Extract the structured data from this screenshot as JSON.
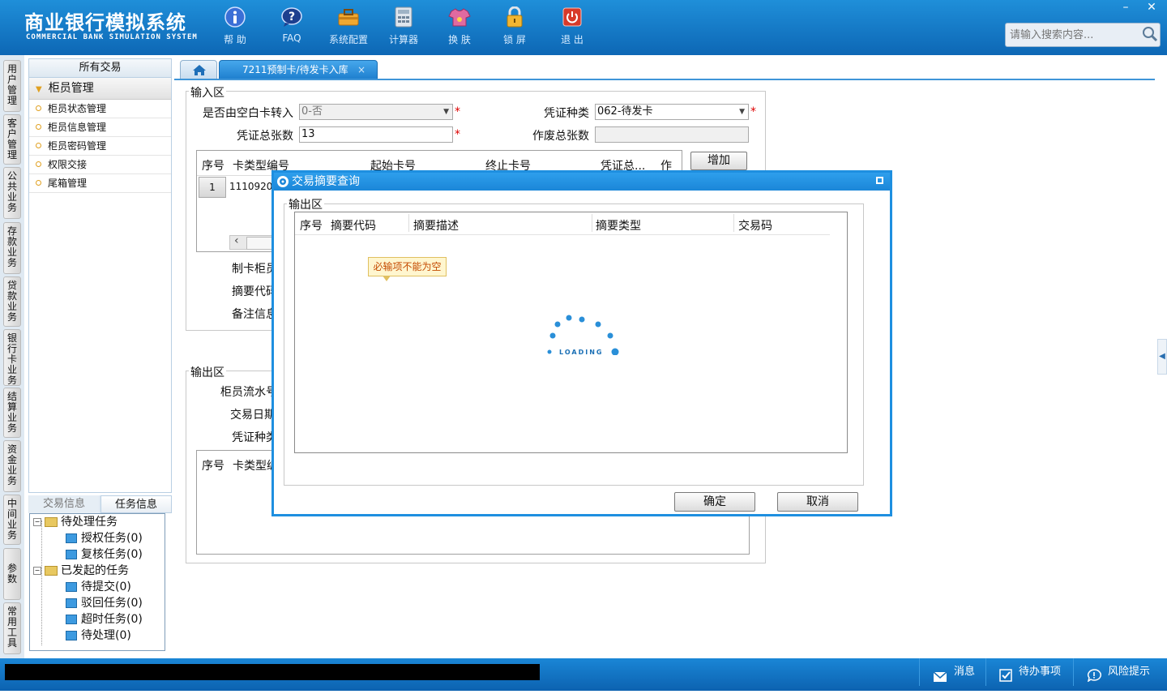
{
  "app": {
    "title_cn": "商业银行模拟系统",
    "title_en": "COMMERCIAL BANK SIMULATION SYSTEM"
  },
  "toolbar": [
    {
      "label": "帮 助",
      "icon": "info-icon"
    },
    {
      "label": "FAQ",
      "icon": "question-icon"
    },
    {
      "label": "系统配置",
      "icon": "toolbox-icon"
    },
    {
      "label": "计算器",
      "icon": "calculator-icon"
    },
    {
      "label": "换 肤",
      "icon": "shirt-icon"
    },
    {
      "label": "锁 屏",
      "icon": "lock-icon"
    },
    {
      "label": "退 出",
      "icon": "power-icon"
    }
  ],
  "search": {
    "placeholder": "请输入搜索内容..."
  },
  "window_controls": {
    "minimize": "–",
    "close": "✕"
  },
  "side_tabs": [
    "用户管理",
    "客户管理",
    "公共业务",
    "存款业务",
    "贷款业务",
    "银行卡业务",
    "结算业务",
    "资金业务",
    "中间业务",
    "参数",
    "常用工具"
  ],
  "menu": {
    "header": "所有交易",
    "group": "柜员管理",
    "items": [
      "柜员状态管理",
      "柜员信息管理",
      "柜员密码管理",
      "权限交接",
      "尾箱管理"
    ]
  },
  "task_panel": {
    "tabs": [
      "交易信息",
      "任务信息"
    ],
    "pending_label": "待处理任务",
    "pending_items": [
      "授权任务(0)",
      "复核任务(0)"
    ],
    "initiated_label": "已发起的任务",
    "initiated_items": [
      "待提交(0)",
      "驳回任务(0)",
      "超时任务(0)",
      "待处理(0)"
    ]
  },
  "tabs": {
    "active": "7211预制卡/待发卡入库",
    "close": "×"
  },
  "form": {
    "input_legend": "输入区",
    "blank_card_label": "是否由空白卡转入",
    "blank_card_value": "0-否",
    "voucher_type_label": "凭证种类",
    "voucher_type_value": "062-待发卡",
    "total_label": "凭证总张数",
    "total_value": "13",
    "void_label": "作废总张数",
    "void_value": "",
    "add_button": "增加",
    "grid_headers": [
      "序号",
      "卡类型编号",
      "起始卡号",
      "终止卡号",
      "凭证总...",
      "作废"
    ],
    "grid_row": {
      "index": "1",
      "card_type": "1110920"
    },
    "scroll_left": "‹",
    "maker_label": "制卡柜员",
    "summary_label": "摘要代码",
    "remark_label": "备注信息",
    "output_legend": "输出区",
    "teller_serial_label": "柜员流水号",
    "trade_date_label": "交易日期",
    "voucher_type2_label": "凭证种类",
    "out_grid_headers": [
      "序号",
      "卡类型编号"
    ],
    "required_mark": "*"
  },
  "modal": {
    "title": "交易摘要查询",
    "legend": "输出区",
    "headers": [
      "序号",
      "摘要代码",
      "摘要描述",
      "摘要类型",
      "交易码"
    ],
    "tooltip": "必输项不能为空",
    "loading": "LOADING",
    "ok": "确定",
    "cancel": "取消"
  },
  "statusbar": {
    "message": "消息",
    "todo": "待办事项",
    "risk": "风险提示"
  },
  "colors": {
    "header_blue": "#0d67b5",
    "accent": "#1e8fe0",
    "required": "#dd0000",
    "tooltip_bg": "#fff6cf"
  }
}
